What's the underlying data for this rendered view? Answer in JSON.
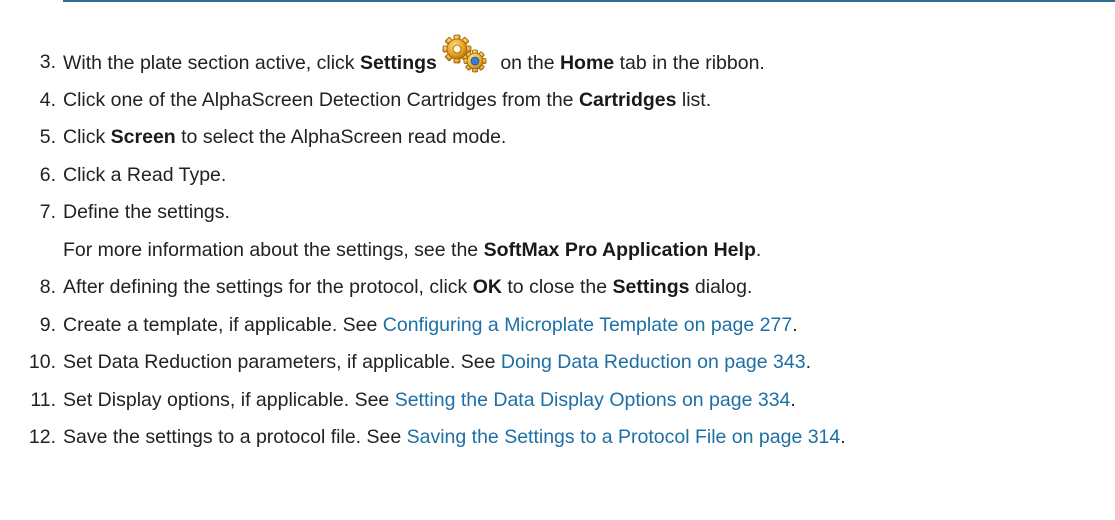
{
  "steps": [
    {
      "number": "3.",
      "parts": [
        "With the plate section active, click ",
        "Settings",
        " on the ",
        "Home",
        " tab in the ribbon."
      ],
      "icon": "gears-settings-icon"
    },
    {
      "number": "4.",
      "parts": [
        "Click one of the AlphaScreen Detection Cartridges from the ",
        "Cartridges",
        " list."
      ]
    },
    {
      "number": "5.",
      "parts": [
        "Click ",
        "Screen",
        " to select the AlphaScreen read mode."
      ]
    },
    {
      "number": "6.",
      "parts": [
        "Click a Read Type."
      ]
    },
    {
      "number": "7.",
      "parts": [
        "Define the settings."
      ],
      "sub_parts": [
        "For more information about the settings, see the ",
        "SoftMax Pro Application Help",
        "."
      ]
    },
    {
      "number": "8.",
      "parts": [
        "After defining the settings for the protocol, click ",
        "OK",
        " to close the ",
        "Settings",
        " dialog."
      ]
    },
    {
      "number": "9.",
      "parts": [
        "Create a template, if applicable. See ",
        "Configuring a Microplate Template on page 277",
        "."
      ]
    },
    {
      "number": "10.",
      "parts": [
        "Set Data Reduction parameters, if applicable. See ",
        "Doing Data Reduction on page 343",
        "."
      ]
    },
    {
      "number": "11.",
      "parts": [
        "Set Display options, if applicable. See ",
        "Setting the Data Display Options on page 334",
        "."
      ]
    },
    {
      "number": "12.",
      "parts": [
        "Save the settings to a protocol file. See ",
        "Saving the Settings to a Protocol File on page 314",
        "."
      ]
    }
  ],
  "colors": {
    "text": "#222222",
    "link": "#1d6fa5",
    "rule": "#2e6e8e",
    "gear": "#e9a521"
  }
}
